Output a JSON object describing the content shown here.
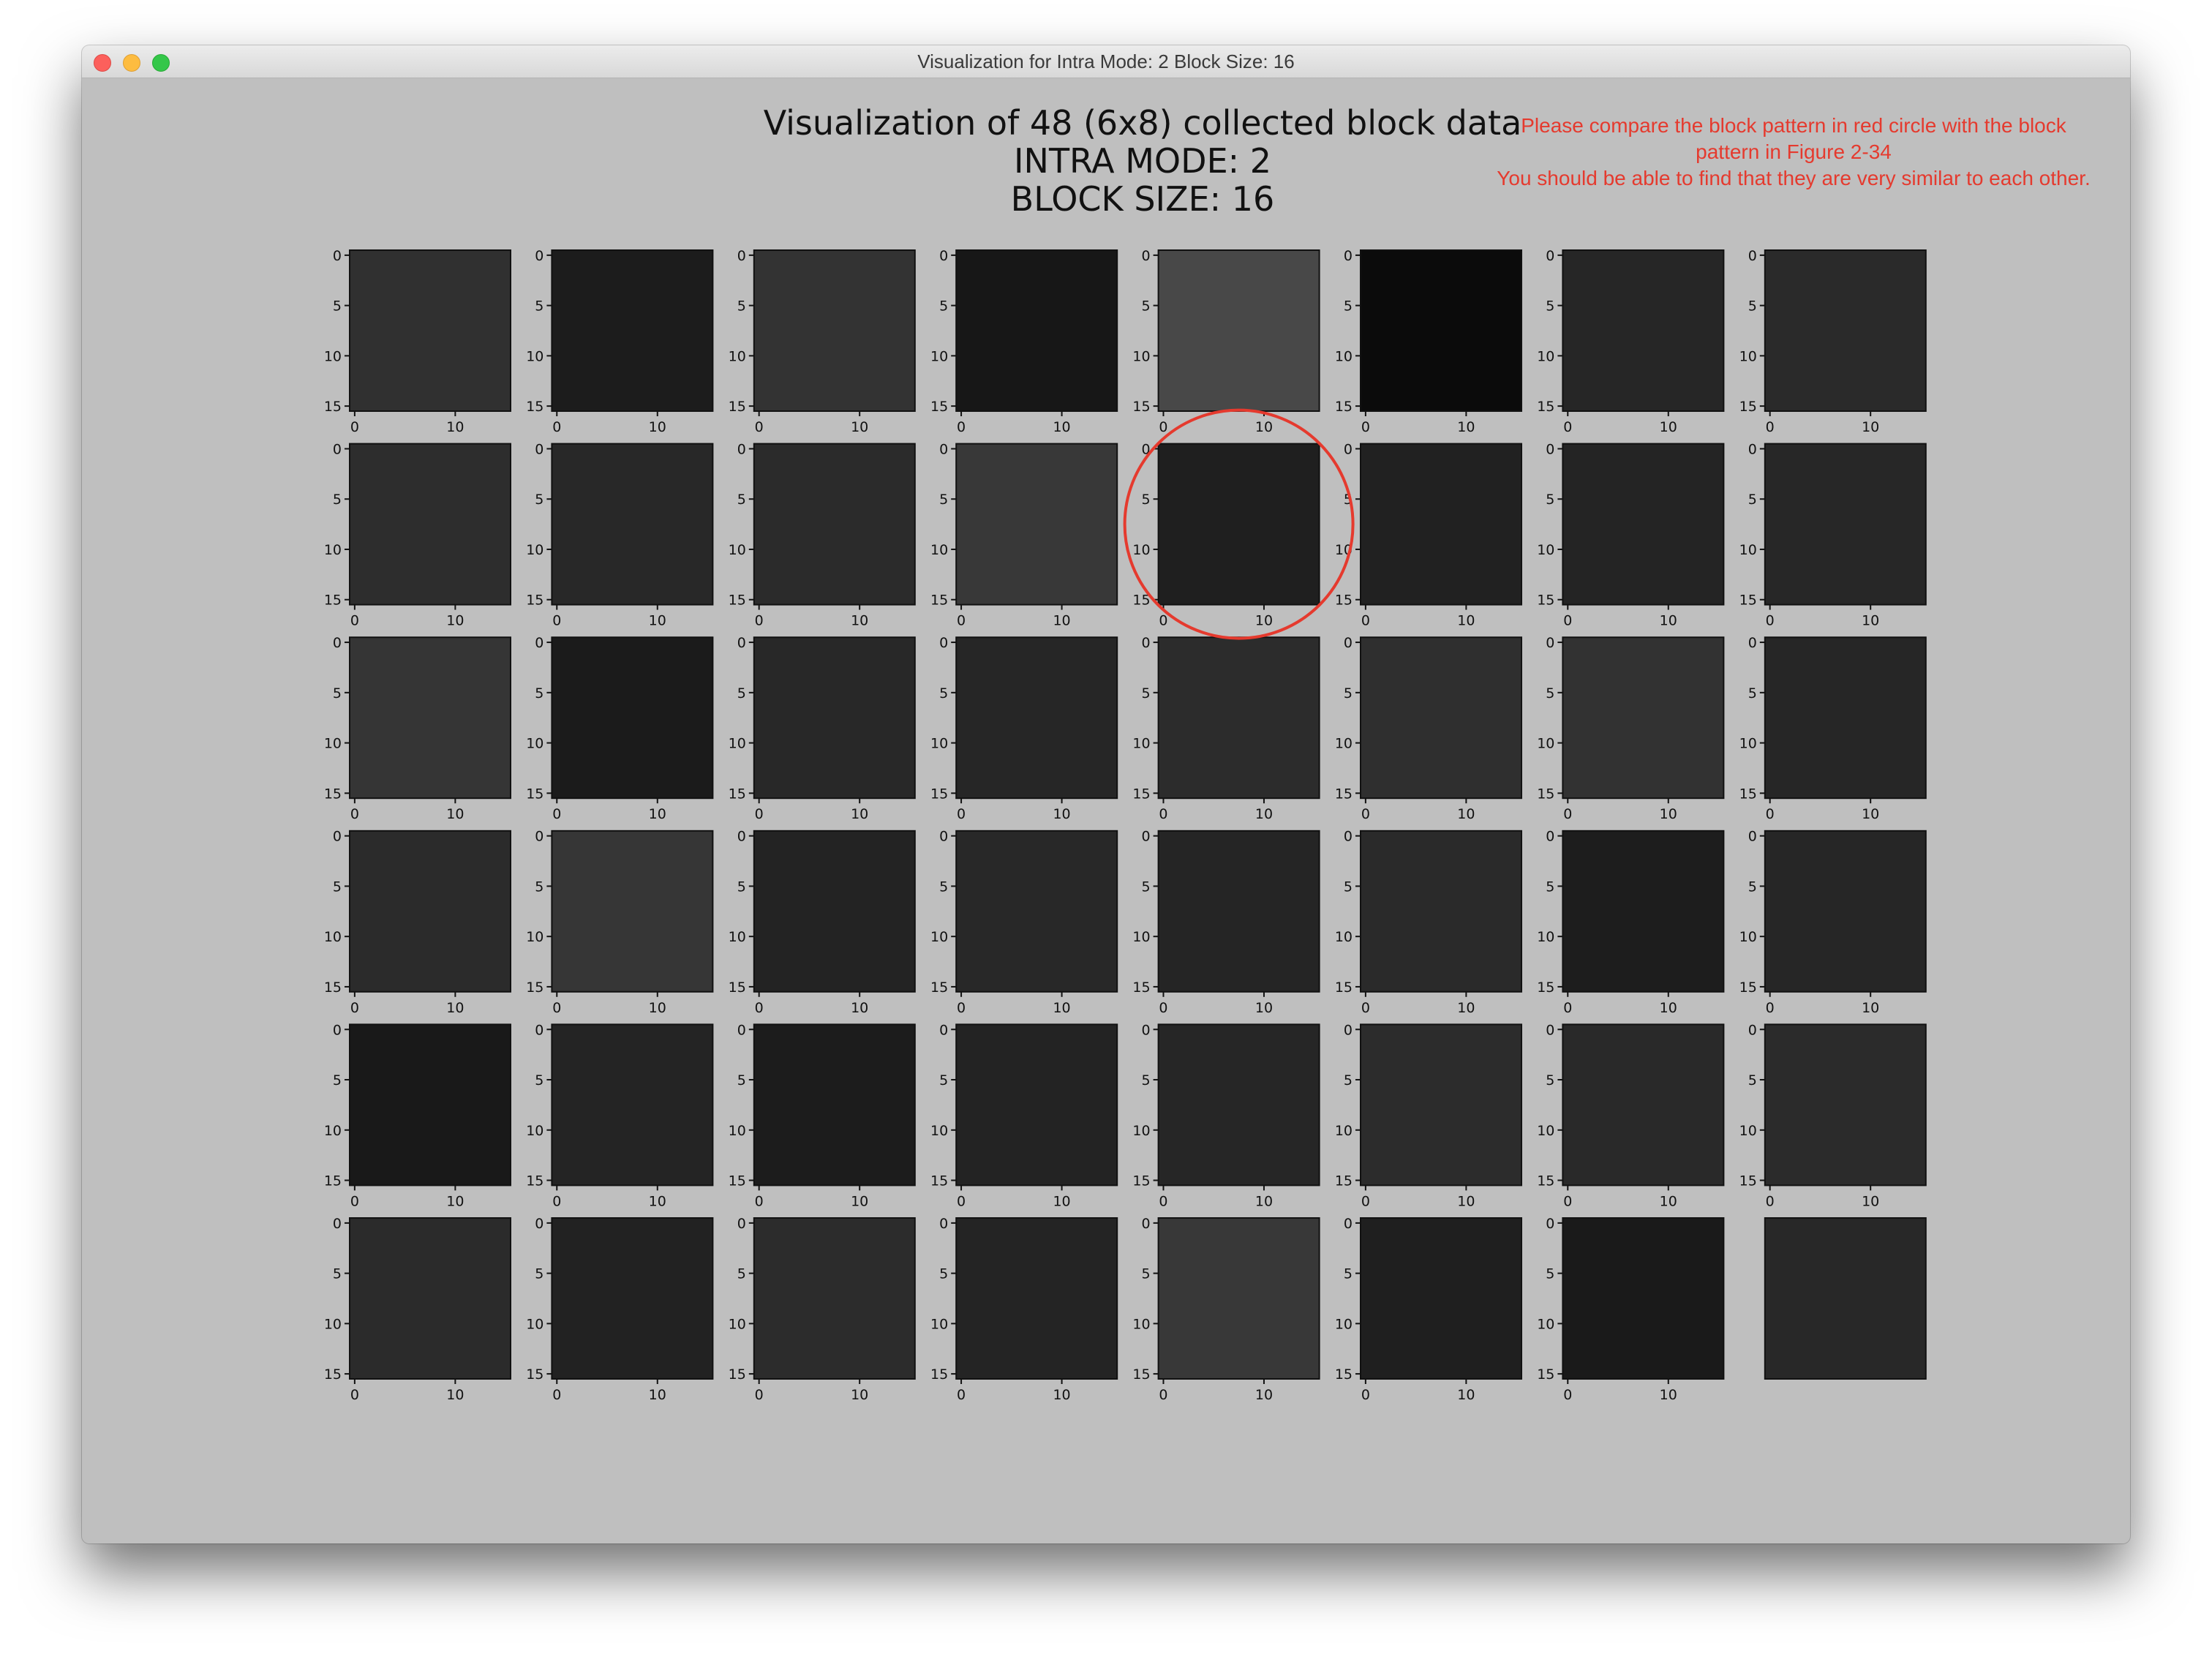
{
  "window": {
    "title": "Visualization for Intra Mode: 2 Block Size: 16"
  },
  "figure": {
    "title_lines": [
      "Visualization of 48 (6x8) collected block data",
      "INTRA MODE: 2",
      "BLOCK SIZE: 16"
    ],
    "annotation": "Please compare the block pattern in red circle with the block pattern in Figure 2-34\nYou should be able to find that they are very similar to each other.",
    "highlight_color": "#e53a2e"
  },
  "chart_data": {
    "type": "heatmap",
    "layout": {
      "rows": 6,
      "cols": 8
    },
    "y_ticks": [
      "0",
      "5",
      "10",
      "15"
    ],
    "x_ticks": [
      "0",
      "10"
    ],
    "highlighted_block": {
      "row": 2,
      "col": 5
    },
    "last_block_axes_hidden": true,
    "blocks": [
      [
        "#303030",
        "#1c1c1c",
        "#333333",
        "#171717",
        "#484848",
        "#0b0b0b",
        "#262626",
        "#2a2a2a"
      ],
      [
        "#2d2d2d",
        "#282828",
        "#2b2b2b",
        "#383838",
        "#1f1f1f",
        "#212121",
        "#242424",
        "#272727"
      ],
      [
        "#353535",
        "#1b1b1b",
        "#282828",
        "#262626",
        "#2c2c2c",
        "#2f2f2f",
        "#323232",
        "#262626"
      ],
      [
        "#2b2b2b",
        "#363636",
        "#232323",
        "#282828",
        "#252525",
        "#2a2a2a",
        "#1d1d1d",
        "#262626"
      ],
      [
        "#191919",
        "#242424",
        "#1c1c1c",
        "#232323",
        "#262626",
        "#2c2c2c",
        "#292929",
        "#2b2b2b"
      ],
      [
        "#2b2b2b",
        "#222222",
        "#2c2c2c",
        "#242424",
        "#383838",
        "#1f1f1f",
        "#1a1a1a",
        "#282828"
      ]
    ]
  }
}
